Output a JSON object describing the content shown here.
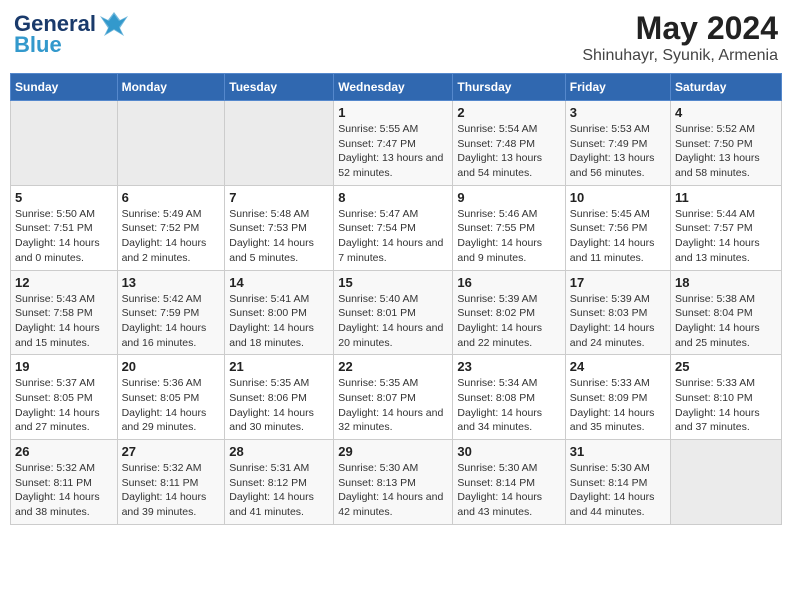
{
  "logo": {
    "main": "General",
    "accent": "Blue",
    "bird": "🔷"
  },
  "title": "May 2024",
  "subtitle": "Shinuhayr, Syunik, Armenia",
  "weekdays": [
    "Sunday",
    "Monday",
    "Tuesday",
    "Wednesday",
    "Thursday",
    "Friday",
    "Saturday"
  ],
  "weeks": [
    [
      {
        "day": "",
        "sunrise": "",
        "sunset": "",
        "daylight": ""
      },
      {
        "day": "",
        "sunrise": "",
        "sunset": "",
        "daylight": ""
      },
      {
        "day": "",
        "sunrise": "",
        "sunset": "",
        "daylight": ""
      },
      {
        "day": "1",
        "sunrise": "Sunrise: 5:55 AM",
        "sunset": "Sunset: 7:47 PM",
        "daylight": "Daylight: 13 hours and 52 minutes."
      },
      {
        "day": "2",
        "sunrise": "Sunrise: 5:54 AM",
        "sunset": "Sunset: 7:48 PM",
        "daylight": "Daylight: 13 hours and 54 minutes."
      },
      {
        "day": "3",
        "sunrise": "Sunrise: 5:53 AM",
        "sunset": "Sunset: 7:49 PM",
        "daylight": "Daylight: 13 hours and 56 minutes."
      },
      {
        "day": "4",
        "sunrise": "Sunrise: 5:52 AM",
        "sunset": "Sunset: 7:50 PM",
        "daylight": "Daylight: 13 hours and 58 minutes."
      }
    ],
    [
      {
        "day": "5",
        "sunrise": "Sunrise: 5:50 AM",
        "sunset": "Sunset: 7:51 PM",
        "daylight": "Daylight: 14 hours and 0 minutes."
      },
      {
        "day": "6",
        "sunrise": "Sunrise: 5:49 AM",
        "sunset": "Sunset: 7:52 PM",
        "daylight": "Daylight: 14 hours and 2 minutes."
      },
      {
        "day": "7",
        "sunrise": "Sunrise: 5:48 AM",
        "sunset": "Sunset: 7:53 PM",
        "daylight": "Daylight: 14 hours and 5 minutes."
      },
      {
        "day": "8",
        "sunrise": "Sunrise: 5:47 AM",
        "sunset": "Sunset: 7:54 PM",
        "daylight": "Daylight: 14 hours and 7 minutes."
      },
      {
        "day": "9",
        "sunrise": "Sunrise: 5:46 AM",
        "sunset": "Sunset: 7:55 PM",
        "daylight": "Daylight: 14 hours and 9 minutes."
      },
      {
        "day": "10",
        "sunrise": "Sunrise: 5:45 AM",
        "sunset": "Sunset: 7:56 PM",
        "daylight": "Daylight: 14 hours and 11 minutes."
      },
      {
        "day": "11",
        "sunrise": "Sunrise: 5:44 AM",
        "sunset": "Sunset: 7:57 PM",
        "daylight": "Daylight: 14 hours and 13 minutes."
      }
    ],
    [
      {
        "day": "12",
        "sunrise": "Sunrise: 5:43 AM",
        "sunset": "Sunset: 7:58 PM",
        "daylight": "Daylight: 14 hours and 15 minutes."
      },
      {
        "day": "13",
        "sunrise": "Sunrise: 5:42 AM",
        "sunset": "Sunset: 7:59 PM",
        "daylight": "Daylight: 14 hours and 16 minutes."
      },
      {
        "day": "14",
        "sunrise": "Sunrise: 5:41 AM",
        "sunset": "Sunset: 8:00 PM",
        "daylight": "Daylight: 14 hours and 18 minutes."
      },
      {
        "day": "15",
        "sunrise": "Sunrise: 5:40 AM",
        "sunset": "Sunset: 8:01 PM",
        "daylight": "Daylight: 14 hours and 20 minutes."
      },
      {
        "day": "16",
        "sunrise": "Sunrise: 5:39 AM",
        "sunset": "Sunset: 8:02 PM",
        "daylight": "Daylight: 14 hours and 22 minutes."
      },
      {
        "day": "17",
        "sunrise": "Sunrise: 5:39 AM",
        "sunset": "Sunset: 8:03 PM",
        "daylight": "Daylight: 14 hours and 24 minutes."
      },
      {
        "day": "18",
        "sunrise": "Sunrise: 5:38 AM",
        "sunset": "Sunset: 8:04 PM",
        "daylight": "Daylight: 14 hours and 25 minutes."
      }
    ],
    [
      {
        "day": "19",
        "sunrise": "Sunrise: 5:37 AM",
        "sunset": "Sunset: 8:05 PM",
        "daylight": "Daylight: 14 hours and 27 minutes."
      },
      {
        "day": "20",
        "sunrise": "Sunrise: 5:36 AM",
        "sunset": "Sunset: 8:05 PM",
        "daylight": "Daylight: 14 hours and 29 minutes."
      },
      {
        "day": "21",
        "sunrise": "Sunrise: 5:35 AM",
        "sunset": "Sunset: 8:06 PM",
        "daylight": "Daylight: 14 hours and 30 minutes."
      },
      {
        "day": "22",
        "sunrise": "Sunrise: 5:35 AM",
        "sunset": "Sunset: 8:07 PM",
        "daylight": "Daylight: 14 hours and 32 minutes."
      },
      {
        "day": "23",
        "sunrise": "Sunrise: 5:34 AM",
        "sunset": "Sunset: 8:08 PM",
        "daylight": "Daylight: 14 hours and 34 minutes."
      },
      {
        "day": "24",
        "sunrise": "Sunrise: 5:33 AM",
        "sunset": "Sunset: 8:09 PM",
        "daylight": "Daylight: 14 hours and 35 minutes."
      },
      {
        "day": "25",
        "sunrise": "Sunrise: 5:33 AM",
        "sunset": "Sunset: 8:10 PM",
        "daylight": "Daylight: 14 hours and 37 minutes."
      }
    ],
    [
      {
        "day": "26",
        "sunrise": "Sunrise: 5:32 AM",
        "sunset": "Sunset: 8:11 PM",
        "daylight": "Daylight: 14 hours and 38 minutes."
      },
      {
        "day": "27",
        "sunrise": "Sunrise: 5:32 AM",
        "sunset": "Sunset: 8:11 PM",
        "daylight": "Daylight: 14 hours and 39 minutes."
      },
      {
        "day": "28",
        "sunrise": "Sunrise: 5:31 AM",
        "sunset": "Sunset: 8:12 PM",
        "daylight": "Daylight: 14 hours and 41 minutes."
      },
      {
        "day": "29",
        "sunrise": "Sunrise: 5:30 AM",
        "sunset": "Sunset: 8:13 PM",
        "daylight": "Daylight: 14 hours and 42 minutes."
      },
      {
        "day": "30",
        "sunrise": "Sunrise: 5:30 AM",
        "sunset": "Sunset: 8:14 PM",
        "daylight": "Daylight: 14 hours and 43 minutes."
      },
      {
        "day": "31",
        "sunrise": "Sunrise: 5:30 AM",
        "sunset": "Sunset: 8:14 PM",
        "daylight": "Daylight: 14 hours and 44 minutes."
      },
      {
        "day": "",
        "sunrise": "",
        "sunset": "",
        "daylight": ""
      }
    ]
  ]
}
